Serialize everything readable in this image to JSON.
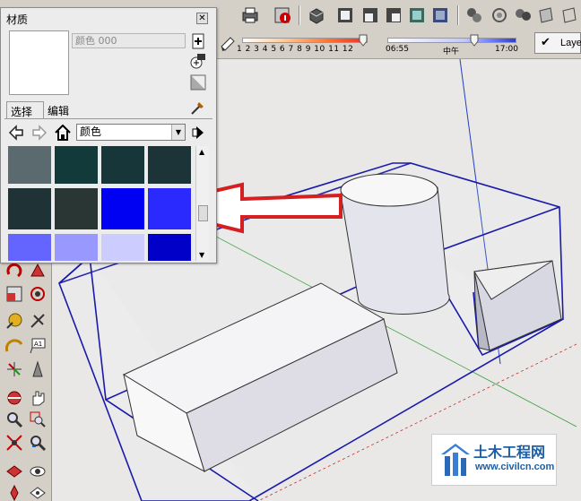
{
  "materials_panel": {
    "title": "材质",
    "close_icon": "close-icon",
    "material_name": "颜色 000",
    "tabs": [
      "选择",
      "编辑"
    ],
    "library": "颜色",
    "swatch_colors": [
      [
        "#5b6a6e",
        "#123a3a",
        "#16363a",
        "#1c3438"
      ],
      [
        "#1f3236",
        "#293634",
        "#0000f2",
        "#2a2aff"
      ],
      [
        "#6464ff",
        "#9898ff",
        "#ccccff",
        "#0000c8"
      ]
    ]
  },
  "shadow_toolbar": {
    "month_ticks": "1 2 3 4 5 6 7 8 9 10 11 12",
    "time_start": "06:55",
    "time_mid": "中午",
    "time_end": "17:00"
  },
  "layer_toolbar": {
    "label": "Laye"
  },
  "watermark": {
    "title": "土木工程网",
    "url": "www.civilcn.com"
  },
  "colors": {
    "edge_blue": "#1a1aaa",
    "arrow_red": "#d42020"
  }
}
